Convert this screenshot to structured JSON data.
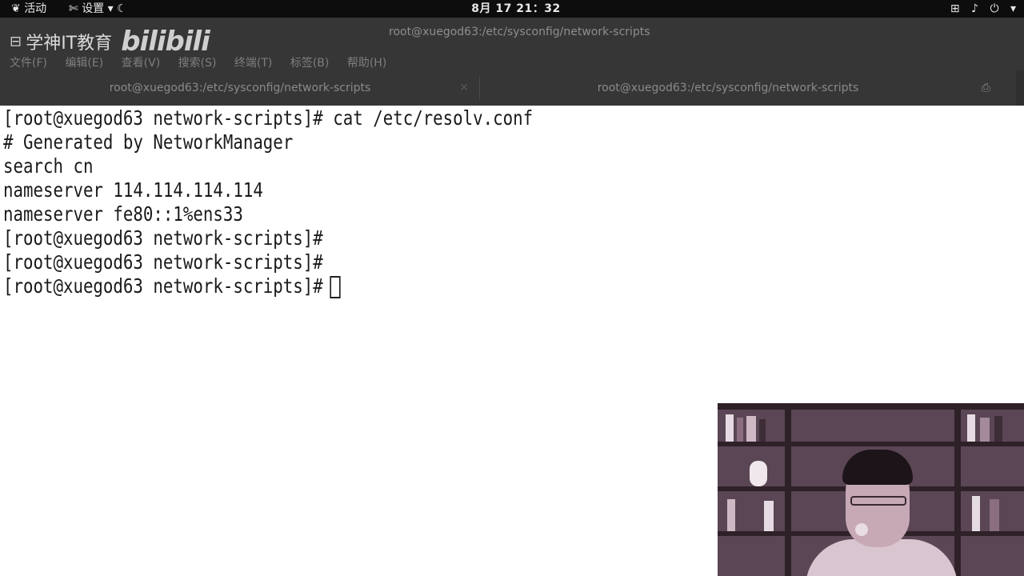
{
  "topbar": {
    "activities": "活动",
    "settings": "设置",
    "clock": "8月 17  21：32",
    "icons": [
      "gnome-foot-icon",
      "wrench-icon",
      "chevron-down-icon",
      "moon-icon",
      "network-icon",
      "volume-icon",
      "power-icon",
      "chevron-down-icon"
    ]
  },
  "window": {
    "brand_text": "学神IT教育",
    "brand_logo": "bilibili",
    "title": "root@xuegod63:/etc/sysconfig/network-scripts",
    "menu": [
      "文件(F)",
      "编辑(E)",
      "查看(V)",
      "搜索(S)",
      "终端(T)",
      "标签(B)",
      "帮助(H)"
    ],
    "tabs": [
      {
        "label": "root@xuegod63:/etc/sysconfig/network-scripts",
        "active": false
      },
      {
        "label": "root@xuegod63:/etc/sysconfig/network-scripts",
        "active": true
      }
    ]
  },
  "terminal": {
    "lines": [
      "[root@xuegod63 network-scripts]# cat /etc/resolv.conf",
      "# Generated by NetworkManager",
      "search cn",
      "nameserver 114.114.114.114",
      "nameserver fe80::1%ens33",
      "[root@xuegod63 network-scripts]#",
      "[root@xuegod63 network-scripts]#",
      "[root@xuegod63 network-scripts]#"
    ]
  },
  "colors": {
    "topbar_bg": "#0d0d0d",
    "header_bg": "#363636",
    "terminal_bg": "#ffffff",
    "terminal_fg": "#1a1a1a"
  }
}
